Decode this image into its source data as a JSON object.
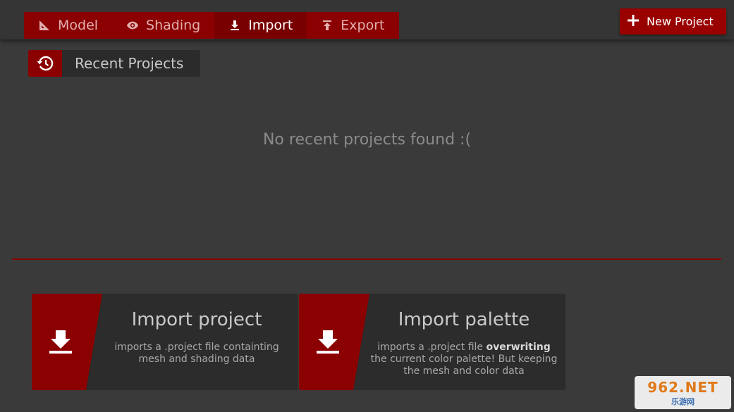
{
  "tabs": [
    {
      "label": "Model",
      "icon": "ruler-triangle-icon"
    },
    {
      "label": "Shading",
      "icon": "eye-icon"
    },
    {
      "label": "Import",
      "icon": "download-icon"
    },
    {
      "label": "Export",
      "icon": "upload-icon"
    }
  ],
  "active_tab": "Import",
  "new_project_label": "New Project",
  "recent": {
    "title": "Recent Projects",
    "empty_message": "No recent projects found :("
  },
  "cards": {
    "project": {
      "title": "Import project",
      "desc": "imports a .project file containting mesh and shading data"
    },
    "palette": {
      "title": "Import palette",
      "desc_pre": "imports a .project file ",
      "desc_bold": "overwriting",
      "desc_post": " the current color palette! But keeping the mesh and color data"
    }
  },
  "watermark": {
    "line1": "962.NET",
    "line2": "乐游网"
  },
  "colors": {
    "accent": "#8b0000",
    "background": "#3a3a3a",
    "topbar": "#353535"
  }
}
